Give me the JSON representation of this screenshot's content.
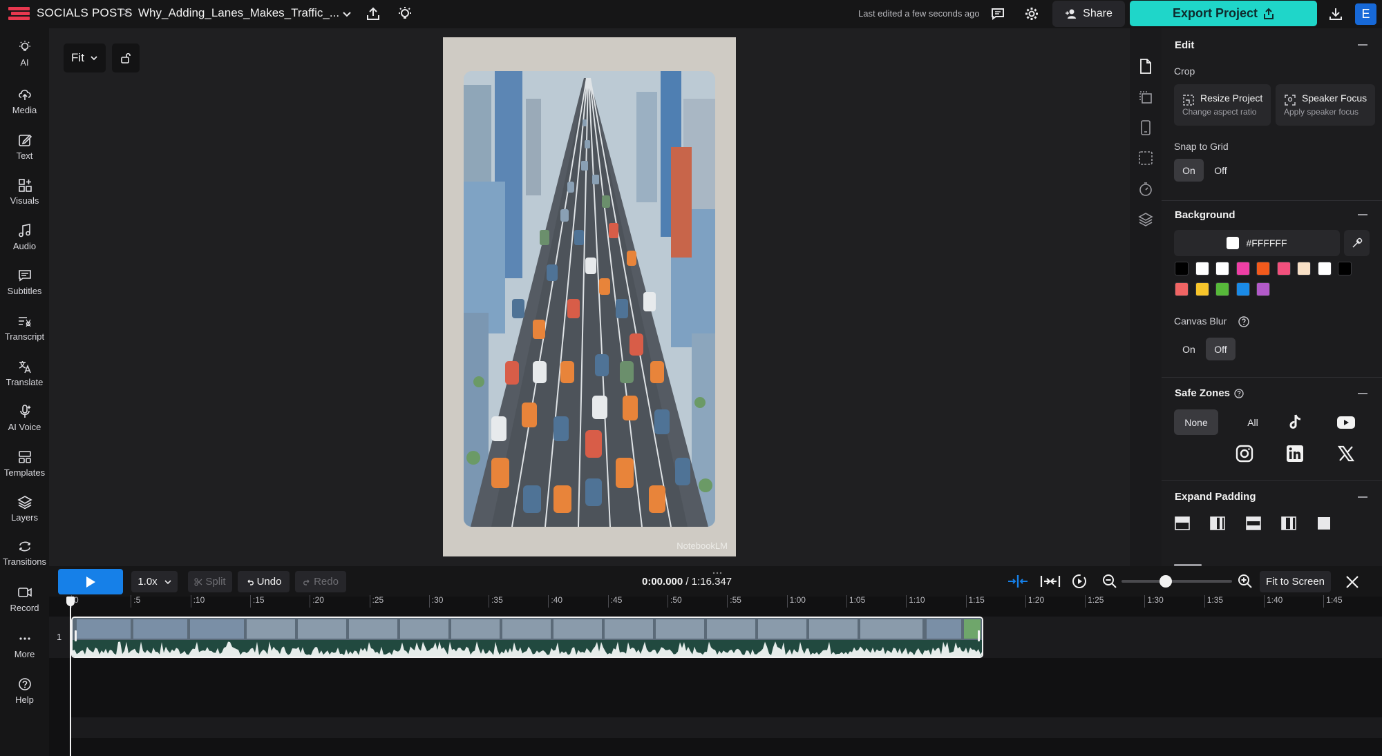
{
  "header": {
    "brand": "SOCIALS POSTS",
    "separator": ">",
    "project_name": "Why_Adding_Lanes_Makes_Traffic_...",
    "last_edited": "Last edited a few seconds ago",
    "share_label": "Share",
    "export_label": "Export Project",
    "avatar_initial": "E"
  },
  "sidebar": {
    "items": [
      {
        "label": "AI",
        "icon": "bulb-icon"
      },
      {
        "label": "Media",
        "icon": "upload-icon"
      },
      {
        "label": "Text",
        "icon": "edit-icon"
      },
      {
        "label": "Visuals",
        "icon": "shapes-icon"
      },
      {
        "label": "Audio",
        "icon": "music-icon"
      },
      {
        "label": "Subtitles",
        "icon": "subtitles-icon"
      },
      {
        "label": "Transcript",
        "icon": "transcript-icon"
      },
      {
        "label": "Translate",
        "icon": "translate-icon"
      },
      {
        "label": "AI Voice",
        "icon": "microphone-icon"
      },
      {
        "label": "Templates",
        "icon": "templates-icon"
      },
      {
        "label": "Layers",
        "icon": "layers-icon"
      },
      {
        "label": "Transitions",
        "icon": "transitions-icon"
      },
      {
        "label": "Record",
        "icon": "record-icon"
      },
      {
        "label": "More",
        "icon": "more-icon"
      },
      {
        "label": "Help",
        "icon": "help-icon"
      }
    ]
  },
  "canvas": {
    "fit_label": "Fit",
    "watermark": "NotebookLM"
  },
  "panel": {
    "edit": {
      "title": "Edit",
      "crop_label": "Crop",
      "resize_title": "Resize Project",
      "resize_sub": "Change aspect ratio",
      "speaker_title": "Speaker Focus",
      "speaker_sub": "Apply speaker focus",
      "snap_label": "Snap to Grid",
      "snap_on": "On",
      "snap_off": "Off",
      "snap_value": "On"
    },
    "background": {
      "title": "Background",
      "hex": "#FFFFFF",
      "swatches": [
        "#000000",
        "#ffffff",
        "#ffffff",
        "#ee3fa5",
        "#f25a1c",
        "#f2507d",
        "#f8e0c6",
        "#ffffff",
        "#000000",
        "#f06464",
        "#f7c52b",
        "#57b83a",
        "#1a8ae6",
        "#b25ac9"
      ],
      "canvas_blur_label": "Canvas Blur",
      "blur_on": "On",
      "blur_off": "Off",
      "blur_value": "Off"
    },
    "safe_zones": {
      "title": "Safe Zones",
      "none_label": "None",
      "all_label": "All",
      "selected": "None",
      "platforms": [
        "tiktok-icon",
        "youtube-icon",
        "instagram-icon",
        "linkedin-icon",
        "x-icon"
      ]
    },
    "expand_padding": {
      "title": "Expand Padding"
    }
  },
  "timeline": {
    "speed": "1.0x",
    "split_label": "Split",
    "undo_label": "Undo",
    "redo_label": "Redo",
    "current_time": "0:00.000",
    "duration": "/ 1:16.347",
    "fit_to_screen": "Fit to Screen",
    "zoom_level": 0.4,
    "track_number": "1",
    "ruler": [
      "0",
      ":5",
      ":10",
      ":15",
      ":20",
      ":25",
      ":30",
      ":35",
      ":40",
      ":45",
      ":50",
      ":55",
      "1:00",
      "1:05",
      "1:10",
      "1:15",
      "1:20",
      "1:25",
      "1:30",
      "1:35",
      "1:40",
      "1:45"
    ]
  },
  "colors": {
    "accent_export": "#1fd6c9",
    "accent_play": "#1680e8",
    "avatar": "#1769d8"
  }
}
